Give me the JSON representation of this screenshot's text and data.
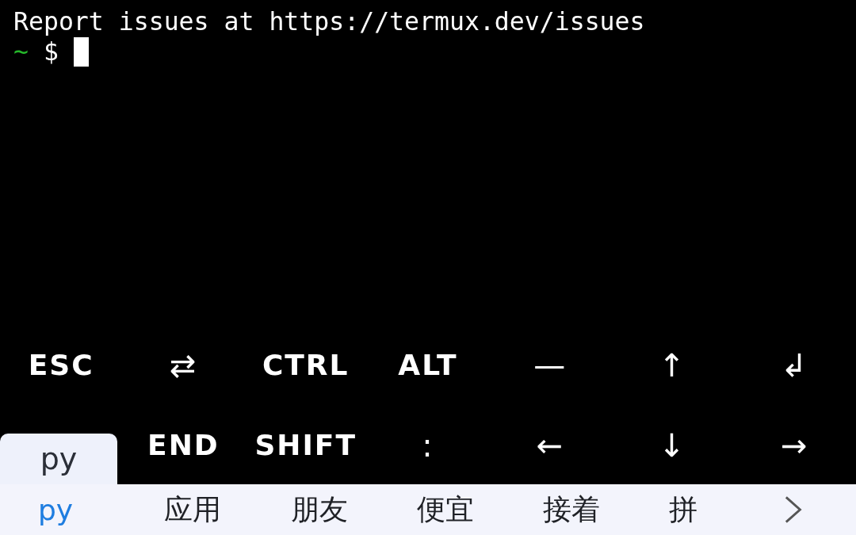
{
  "terminal": {
    "lines": [
      "Report issues at https://termux.dev/issues"
    ],
    "prompt": {
      "symbol": "~",
      "sign": "$"
    }
  },
  "extra_keys": {
    "rows": [
      [
        "ESC",
        "⇄",
        "CTRL",
        "ALT",
        "—",
        "↑",
        "↲"
      ],
      [
        "",
        "END",
        "SHIFT",
        ":",
        "←",
        "↓",
        "→"
      ]
    ]
  },
  "ime_popup": {
    "text": "py"
  },
  "candidates": [
    {
      "text": "py",
      "selected": true
    },
    {
      "text": "应用",
      "selected": false
    },
    {
      "text": "朋友",
      "selected": false
    },
    {
      "text": "便宜",
      "selected": false
    },
    {
      "text": "接着",
      "selected": false
    },
    {
      "text": "拼",
      "selected": false
    }
  ]
}
